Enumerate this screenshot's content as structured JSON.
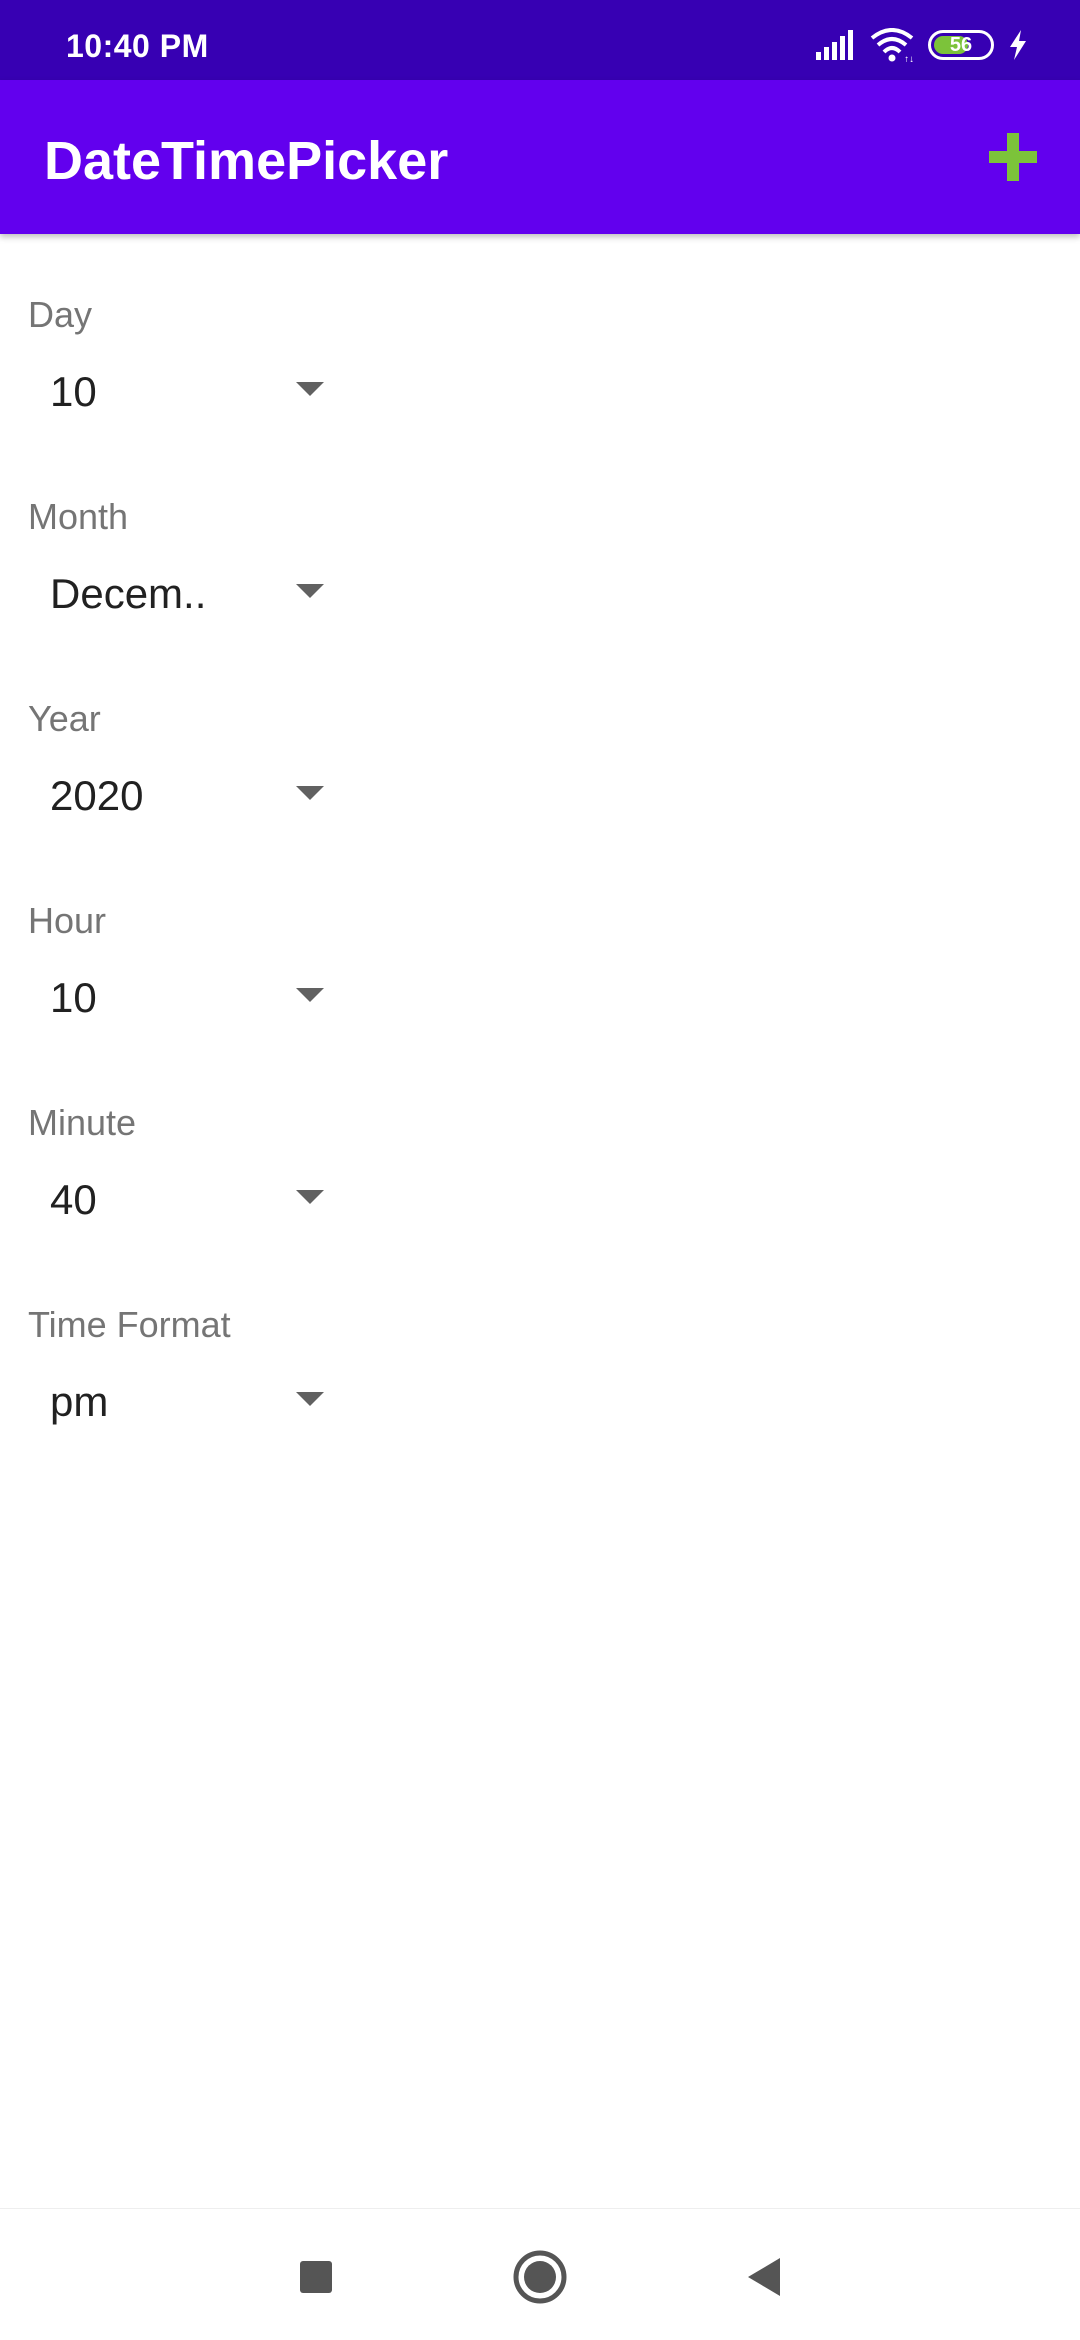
{
  "status_bar": {
    "time": "10:40 PM",
    "battery_level": "56",
    "icons": [
      "signal-icon",
      "wifi-icon",
      "battery-icon",
      "charging-icon"
    ]
  },
  "app_bar": {
    "title": "DateTimePicker",
    "add_icon": "plus-icon",
    "accent_color": "#6200ee",
    "status_color": "#3700b3",
    "plus_color": "#7cc33a"
  },
  "fields": {
    "day": {
      "label": "Day",
      "value": "10"
    },
    "month": {
      "label": "Month",
      "value": "Decem.."
    },
    "year": {
      "label": "Year",
      "value": "2020"
    },
    "hour": {
      "label": "Hour",
      "value": "10"
    },
    "minute": {
      "label": "Minute",
      "value": "40"
    },
    "time_format": {
      "label": "Time Format",
      "value": "pm"
    }
  },
  "nav_bar": {
    "icons": [
      "recent-apps-icon",
      "home-icon",
      "back-icon"
    ]
  }
}
